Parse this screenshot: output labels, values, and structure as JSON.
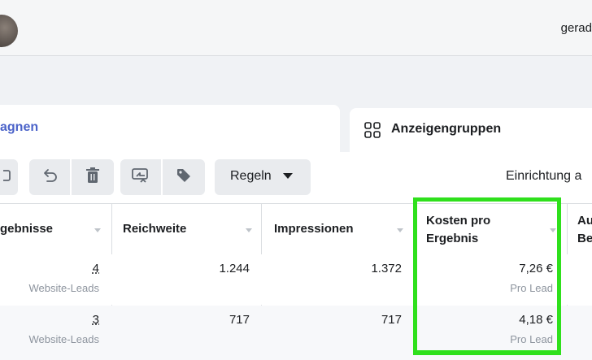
{
  "topbar": {
    "user_text": "gerad"
  },
  "tabs": {
    "active_label": "agnen",
    "inactive_label": "Anzeigengruppen",
    "inactive_icon": "grid-icon"
  },
  "toolbar": {
    "rules_label": "Regeln",
    "setup_text": "Einrichtung a"
  },
  "table": {
    "headers": {
      "results": "gebnisse",
      "reach": "Reichweite",
      "impressions": "Impressionen",
      "cost_line1": "Kosten pro",
      "cost_line2": "Ergebnis",
      "next_line1": "Au",
      "next_line2": "Be"
    },
    "rows": [
      {
        "results": "4",
        "results_sub": "Website-Leads",
        "reach": "1.244",
        "impressions": "1.372",
        "cost": "7,26 €",
        "cost_sub": "Pro Lead"
      },
      {
        "results": "3",
        "results_sub": "Website-Leads",
        "reach": "717",
        "impressions": "717",
        "cost": "4,18 €",
        "cost_sub": "Pro Lead"
      }
    ]
  },
  "colors": {
    "highlight": "#2fe01c",
    "active_tab_text": "#4b63c9"
  }
}
